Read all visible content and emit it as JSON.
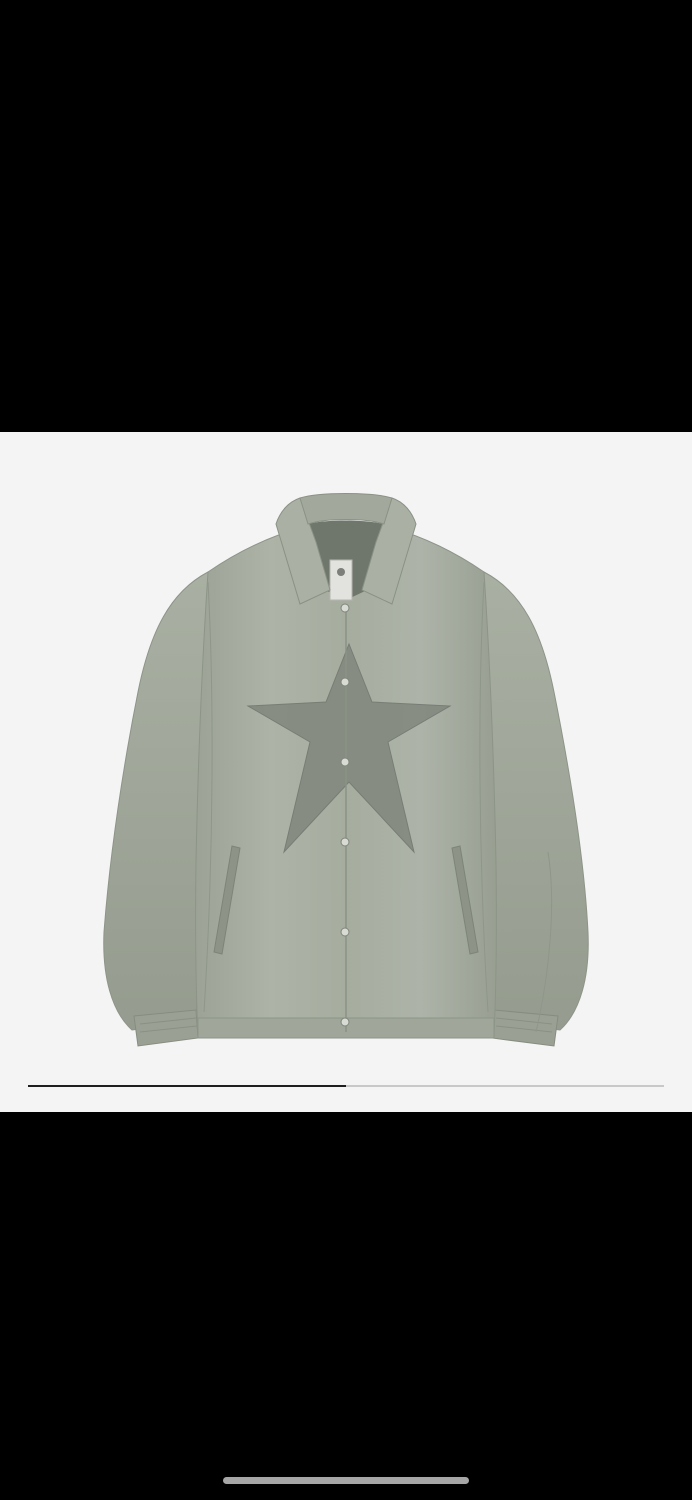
{
  "viewer": {
    "background_color": "#000000",
    "panel_color": "#f4f4f4"
  },
  "image": {
    "subject": "jacket-photo",
    "jacket_color": "#a4ab9f",
    "star_color": "#83877f"
  },
  "carousel": {
    "progress_fraction": 0.5
  },
  "system": {
    "home_indicator_color": "#a6a6a6"
  }
}
